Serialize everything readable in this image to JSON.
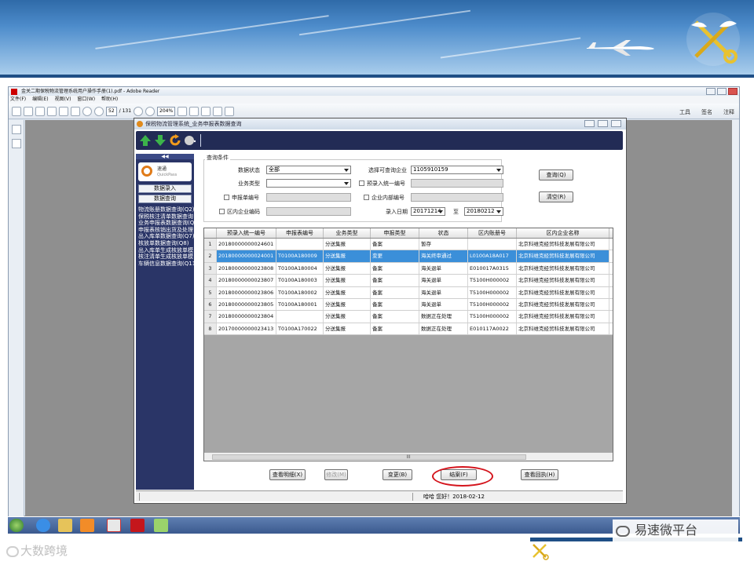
{
  "reader": {
    "title": "金关二期保税物流管理系统用户操作手册(1).pdf - Adobe Reader",
    "menu": [
      "文件(F)",
      "编辑(E)",
      "视图(V)",
      "窗口(W)",
      "帮助(H)"
    ],
    "page_current": "52",
    "page_total": "/ 131",
    "zoom": "204%",
    "right_tools": [
      "工具",
      "签名",
      "注释"
    ]
  },
  "app": {
    "title": "保税物流管理系统_业务申报表数据查询",
    "sidebar": {
      "collapse": "◀◀",
      "logo_name": "速通",
      "logo_sub": "QuickPass",
      "btn_entry": "数据录入",
      "btn_query": "数据查询",
      "items": [
        "物流账册数据查询(Q2)",
        "保税核注清单数据查询",
        "业务申报表数据查询(Q",
        "申报表核销出货及处理",
        "出入库单数据查询(Q7)",
        "核放单数据查询(Q8)",
        "出入库单生成核放单模",
        "核注清单生成核放单模",
        "车辆信息数据查询(Q11"
      ]
    },
    "query": {
      "section_label": "查询条件",
      "status_label": "数据状态",
      "status_value": "全部",
      "biz_type_label": "业务类型",
      "biz_type_value": "",
      "company_label": "选择可查询企业",
      "company_value": "1105910159",
      "pre_no_label": "预录入统一编号",
      "decl_no_label": "申报单编号",
      "ent_no_label": "企业内部编号",
      "zone_code_label": "区内企业编码",
      "date_label": "录入日期",
      "date_from": "20171214",
      "date_to_label": "至",
      "date_to": "20180212",
      "btn_query": "查询(Q)",
      "btn_clear": "清空(R)"
    },
    "grid": {
      "columns": [
        "预录入统一编号",
        "申报表编号",
        "业务类型",
        "申报类型",
        "状态",
        "区内账册号",
        "区内企业名称"
      ],
      "rows": [
        {
          "n": "1",
          "cells": [
            "20180000000024601",
            "",
            "分送集报",
            "备案",
            "暂存",
            "",
            "北京科维克经贸科技发展有限公司"
          ]
        },
        {
          "n": "2",
          "cells": [
            "20180000000024001",
            "T0100A180009",
            "分送集报",
            "变更",
            "海关终审通过",
            "L0100A18A017",
            "北京科维克经贸科技发展有限公司"
          ]
        },
        {
          "n": "3",
          "cells": [
            "20180000000023808",
            "T0100A180004",
            "分送集报",
            "备案",
            "海关退单",
            "E010017A0315",
            "北京科维克经贸科技发展有限公司"
          ]
        },
        {
          "n": "4",
          "cells": [
            "20180000000023807",
            "T0100A180003",
            "分送集报",
            "备案",
            "海关退单",
            "T5100H000002",
            "北京科维克经贸科技发展有限公司"
          ]
        },
        {
          "n": "5",
          "cells": [
            "20180000000023806",
            "T0100A180002",
            "分送集报",
            "备案",
            "海关退单",
            "T5100H000002",
            "北京科维克经贸科技发展有限公司"
          ]
        },
        {
          "n": "6",
          "cells": [
            "20180000000023805",
            "T0100A180001",
            "分送集报",
            "备案",
            "海关退单",
            "T5100H000002",
            "北京科维克经贸科技发展有限公司"
          ]
        },
        {
          "n": "7",
          "cells": [
            "20180000000023804",
            "",
            "分送集报",
            "备案",
            "数据正在处理",
            "T5100H000002",
            "北京科维克经贸科技发展有限公司"
          ]
        },
        {
          "n": "8",
          "cells": [
            "20170000000023413",
            "T0100A170022",
            "分送集报",
            "备案",
            "数据正在处理",
            "E010117A0022",
            "北京科维克经贸科技发展有限公司"
          ]
        }
      ],
      "scroll_mark": "III"
    },
    "actions": {
      "detail": "查看明细(X)",
      "modify": "修改(M)",
      "change": "变更(B)",
      "close_case": "结案(F)",
      "receipt": "查看回执(H)"
    },
    "status_bar": "哈哈 您好！2018-02-12"
  },
  "footer": {
    "left_brand": "大数跨境",
    "right_brand": "易速微平台"
  },
  "colors": {
    "highlight_row": "#3b8fd9",
    "annotation_red": "#d4141c",
    "sidebar_navy": "#2a3567"
  }
}
